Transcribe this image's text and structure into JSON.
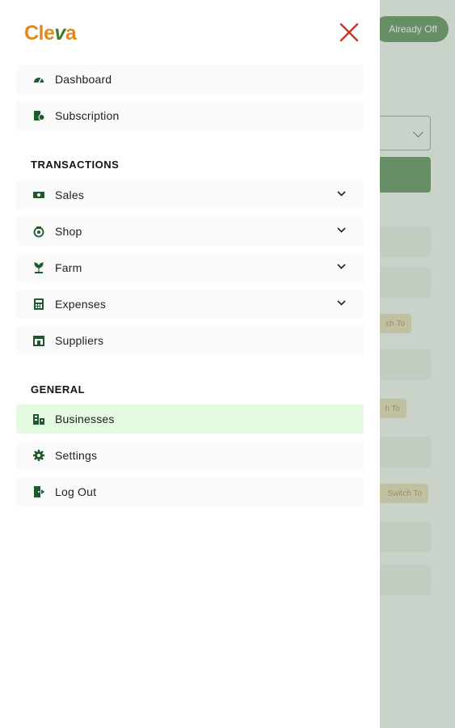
{
  "background": {
    "pill_label": "Already Off",
    "chips": [
      "ch To",
      "h To",
      "Switch To"
    ]
  },
  "drawer": {
    "logo": {
      "part1": "Cle",
      "part2": "v",
      "part3": "a"
    },
    "top_items": [
      {
        "label": "Dashboard",
        "icon": "dashboard-icon"
      },
      {
        "label": "Subscription",
        "icon": "subscription-icon"
      }
    ],
    "transactions_title": "TRANSACTIONS",
    "transaction_items": [
      {
        "label": "Sales",
        "icon": "sales-icon"
      },
      {
        "label": "Shop",
        "icon": "shop-icon"
      },
      {
        "label": "Farm",
        "icon": "farm-icon"
      },
      {
        "label": "Expenses",
        "icon": "expenses-icon"
      },
      {
        "label": "Suppliers",
        "icon": "suppliers-icon"
      }
    ],
    "general_title": "GENERAL",
    "general_items": [
      {
        "label": "Businesses",
        "icon": "businesses-icon",
        "active": true
      },
      {
        "label": "Settings",
        "icon": "settings-icon"
      },
      {
        "label": "Log Out",
        "icon": "logout-icon"
      }
    ]
  },
  "colors": {
    "brand_orange": "#e08a1e",
    "brand_green": "#3e7a2a",
    "close_red": "#c0392b",
    "active_bg": "#e4fae1",
    "icon_green": "#1f5a2c"
  }
}
